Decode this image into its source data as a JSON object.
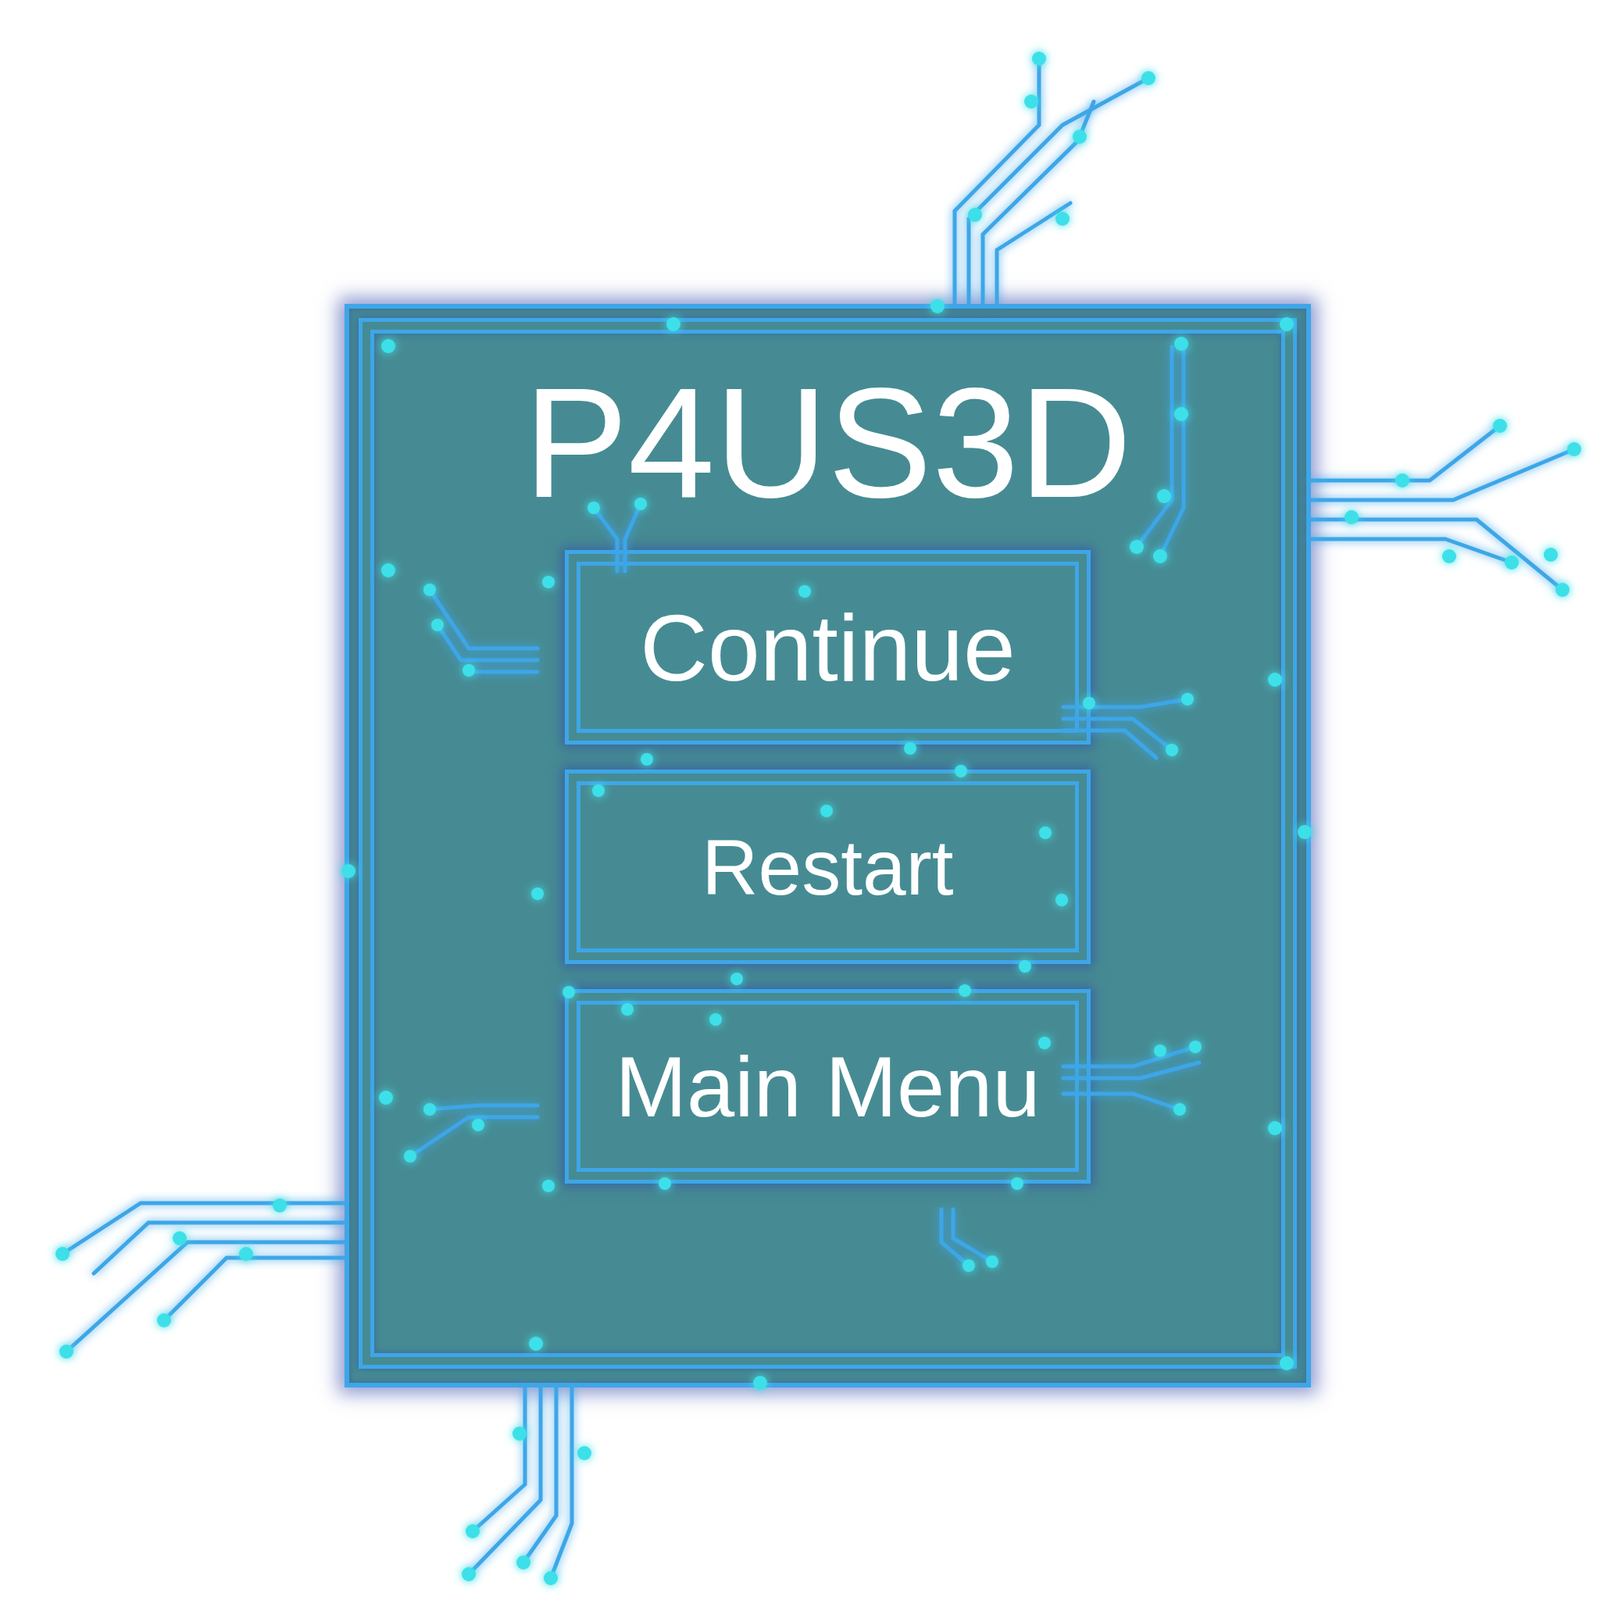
{
  "menu": {
    "title": "P4US3D",
    "buttons": [
      {
        "label": "Continue"
      },
      {
        "label": "Restart"
      },
      {
        "label": "Main Menu"
      }
    ]
  }
}
